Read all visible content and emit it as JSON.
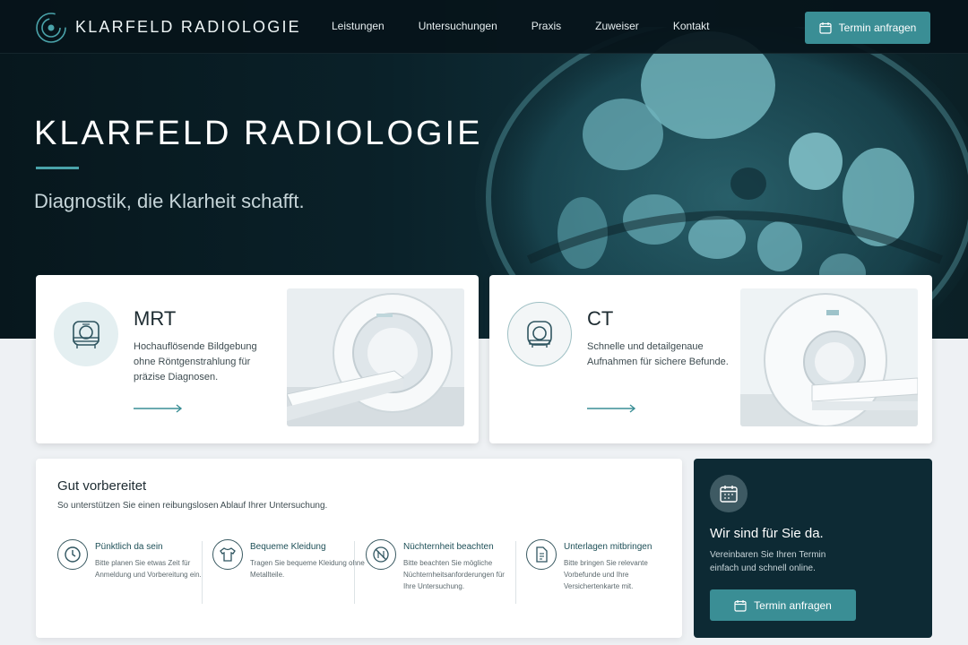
{
  "header": {
    "brand": "KLARFELD RADIOLOGIE",
    "nav": [
      "Leistungen",
      "Untersuchungen",
      "Praxis",
      "Zuweiser",
      "Kontakt"
    ],
    "cta_label": "Termin anfragen"
  },
  "hero": {
    "title": "KLARFELD RADIOLOGIE",
    "subtitle": "Diagnostik, die Klarheit schafft."
  },
  "services": [
    {
      "title": "MRT",
      "description": "Hochauflösende Bildgebung ohne Röntgenstrahlung für präzise Diagnosen.",
      "icon": "mri-scanner-icon"
    },
    {
      "title": "CT",
      "description": "Schnelle und detailgenaue Aufnahmen für sichere Befunde.",
      "icon": "ct-scanner-icon"
    }
  ],
  "prep": {
    "title": "Gut vorbereitet",
    "intro": "So unterstützen Sie einen reibungslosen Ablauf Ihrer Untersuchung.",
    "items": [
      {
        "title": "Pünktlich da sein",
        "text": "Bitte planen Sie etwas Zeit für Anmeldung und Vorbereitung ein.",
        "icon": "clock-icon"
      },
      {
        "title": "Bequeme Kleidung",
        "text": "Tragen Sie bequeme Kleidung ohne Metallteile.",
        "icon": "shirt-icon"
      },
      {
        "title": "Nüchternheit beachten",
        "text": "Bitte beachten Sie mögliche Nüchternheitsanforderungen für Ihre Untersuchung.",
        "icon": "no-food-icon"
      },
      {
        "title": "Unterlagen mitbringen",
        "text": "Bitte bringen Sie relevante Vorbefunde und Ihre Versichertenkarte mit.",
        "icon": "document-icon"
      }
    ]
  },
  "contact": {
    "title": "Wir sind für Sie da.",
    "text": "Vereinbaren Sie Ihren Termin einfach und schnell online.",
    "button_label": "Termin anfragen"
  },
  "colors": {
    "accent": "#3a8e95",
    "dark": "#0d2a34",
    "hero": "#07171d"
  }
}
